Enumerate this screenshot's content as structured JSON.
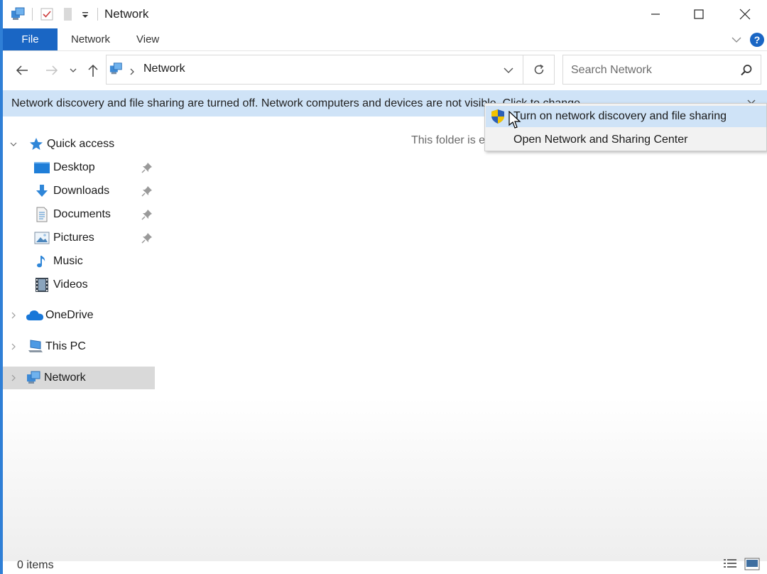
{
  "window": {
    "title": "Network"
  },
  "ribbon": {
    "tabs": [
      "File",
      "Network",
      "View"
    ]
  },
  "address": {
    "location": "Network"
  },
  "search": {
    "placeholder": "Search Network"
  },
  "infobar": {
    "message": "Network discovery and file sharing are turned off. Network computers and devices are not visible. Click to change..."
  },
  "context_menu": {
    "items": [
      {
        "label": "Turn on network discovery and file sharing",
        "icon": "shield-icon",
        "highlighted": true
      },
      {
        "label": "Open Network and Sharing Center",
        "highlighted": false
      }
    ]
  },
  "sidebar": {
    "quick_access": "Quick access",
    "items": [
      {
        "label": "Desktop",
        "icon": "desktop-icon",
        "pinned": true
      },
      {
        "label": "Downloads",
        "icon": "download-icon",
        "pinned": true
      },
      {
        "label": "Documents",
        "icon": "document-icon",
        "pinned": true
      },
      {
        "label": "Pictures",
        "icon": "pictures-icon",
        "pinned": true
      },
      {
        "label": "Music",
        "icon": "music-icon",
        "pinned": false
      },
      {
        "label": "Videos",
        "icon": "video-icon",
        "pinned": false
      }
    ],
    "onedrive": "OneDrive",
    "this_pc": "This PC",
    "network": "Network"
  },
  "content": {
    "empty_text": "This folder is empty."
  },
  "status": {
    "items": "0 items"
  },
  "colors": {
    "accent": "#1a66c4",
    "infobar": "#cfe3f7",
    "selection": "#d9d9d9"
  }
}
